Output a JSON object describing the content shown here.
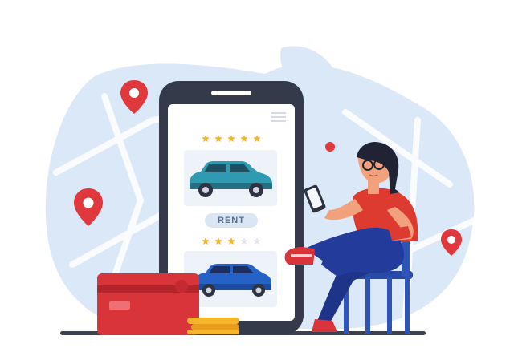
{
  "illustration": {
    "theme": "car-rental-app",
    "colors": {
      "background": "#ffffff",
      "map": "#dbe8f7",
      "phone_frame": "#343a4a",
      "screen": "#ffffff",
      "card": "#d8343a",
      "coin": "#f4b52a",
      "teal_car": "#2e9bb2",
      "blue_car": "#2462c8",
      "star": "#f4b52a",
      "pin": "#e0383c",
      "shirt": "#de3b30",
      "pants": "#233c9c",
      "chair": "#2f54b8"
    }
  },
  "phone": {
    "menu_icon": "hamburger-icon",
    "listings": [
      {
        "car": "teal-suv-icon",
        "rating": 5,
        "max_rating": 5
      },
      {
        "car": "blue-suv-icon",
        "rating": 3,
        "max_rating": 5
      }
    ],
    "rent_label": "RENT"
  }
}
